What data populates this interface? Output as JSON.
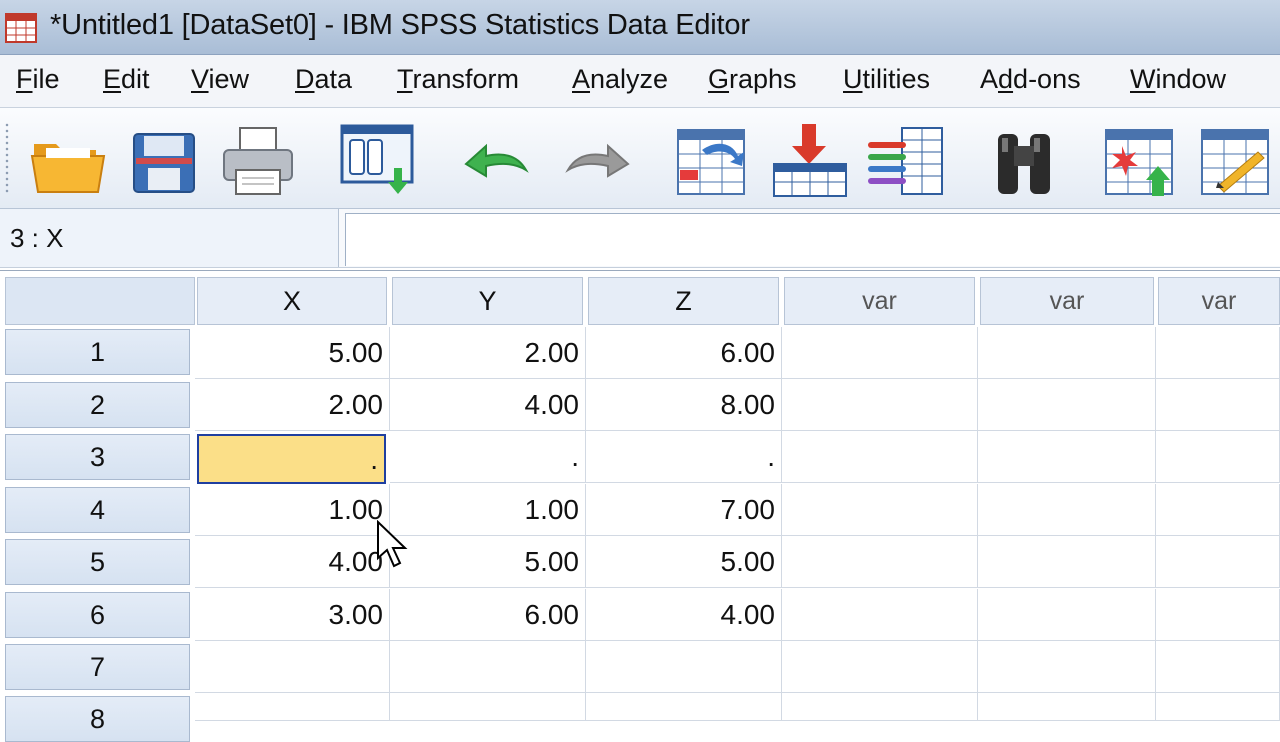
{
  "window": {
    "title": "*Untitled1 [DataSet0] - IBM SPSS Statistics Data Editor"
  },
  "menu": [
    {
      "label": "File",
      "ul": "F",
      "rest": "ile"
    },
    {
      "label": "Edit",
      "ul": "E",
      "rest": "dit"
    },
    {
      "label": "View",
      "ul": "V",
      "rest": "iew"
    },
    {
      "label": "Data",
      "ul": "D",
      "rest": "ata"
    },
    {
      "label": "Transform",
      "ul": "T",
      "rest": "ransform"
    },
    {
      "label": "Analyze",
      "ul": "A",
      "rest": "nalyze"
    },
    {
      "label": "Graphs",
      "ul": "G",
      "rest": "raphs"
    },
    {
      "label": "Utilities",
      "ul": "U",
      "rest": "tilities"
    },
    {
      "label": "Add-ons",
      "pre": "A",
      "ul": "d",
      "rest": "d-ons"
    },
    {
      "label": "Window",
      "ul": "W",
      "rest": "indow"
    }
  ],
  "toolbar": [
    {
      "icon": "open-folder-icon"
    },
    {
      "icon": "save-icon"
    },
    {
      "icon": "print-icon"
    },
    {
      "icon": "recall-dialog-icon"
    },
    {
      "icon": "undo-icon"
    },
    {
      "icon": "redo-icon"
    },
    {
      "icon": "go-to-case-icon"
    },
    {
      "icon": "go-to-variable-icon"
    },
    {
      "icon": "variables-icon"
    },
    {
      "icon": "find-icon"
    },
    {
      "icon": "insert-cases-icon"
    },
    {
      "icon": "insert-variable-icon"
    }
  ],
  "cell_editor": {
    "reference": "3 : X",
    "value": ""
  },
  "grid": {
    "columns": [
      "X",
      "Y",
      "Z",
      "var",
      "var",
      "var"
    ],
    "rows": [
      {
        "num": "1",
        "cells": [
          "5.00",
          "2.00",
          "6.00",
          "",
          "",
          ""
        ]
      },
      {
        "num": "2",
        "cells": [
          "2.00",
          "4.00",
          "8.00",
          "",
          "",
          ""
        ]
      },
      {
        "num": "3",
        "cells": [
          ".",
          ".",
          ".",
          "",
          "",
          ""
        ]
      },
      {
        "num": "4",
        "cells": [
          "1.00",
          "1.00",
          "7.00",
          "",
          "",
          ""
        ]
      },
      {
        "num": "5",
        "cells": [
          "4.00",
          "5.00",
          "5.00",
          "",
          "",
          ""
        ]
      },
      {
        "num": "6",
        "cells": [
          "3.00",
          "6.00",
          "4.00",
          "",
          "",
          ""
        ]
      },
      {
        "num": "7",
        "cells": [
          "",
          "",
          "",
          "",
          "",
          ""
        ]
      },
      {
        "num": "8",
        "cells": [
          "",
          "",
          "",
          "",
          "",
          ""
        ]
      }
    ],
    "selected_cell": {
      "row": "3",
      "column": "X"
    }
  },
  "colors": {
    "selected_cell_fill": "#fbdf88",
    "selected_cell_border": "#1f3fa0",
    "header_fill": "#e6edf7"
  }
}
